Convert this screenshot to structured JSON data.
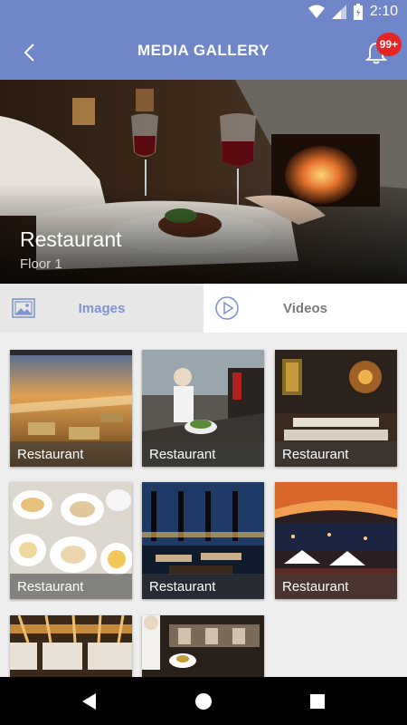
{
  "status_bar": {
    "time": "2:10"
  },
  "header": {
    "title": "MEDIA GALLERY",
    "notification_badge": "99+"
  },
  "hero": {
    "title": "Restaurant",
    "subtitle": "Floor 1"
  },
  "tabs": [
    {
      "label": "Images",
      "active": true,
      "icon": "image-icon"
    },
    {
      "label": "Videos",
      "active": false,
      "icon": "play-circle-icon"
    }
  ],
  "gallery": {
    "items": [
      {
        "label": "Restaurant"
      },
      {
        "label": "Restaurant"
      },
      {
        "label": "Restaurant"
      },
      {
        "label": "Restaurant"
      },
      {
        "label": "Restaurant"
      },
      {
        "label": "Restaurant"
      },
      {
        "label": ""
      },
      {
        "label": ""
      }
    ]
  },
  "colors": {
    "primary": "#6f86c9",
    "accent": "#7f94cf",
    "badge": "#e52525"
  }
}
